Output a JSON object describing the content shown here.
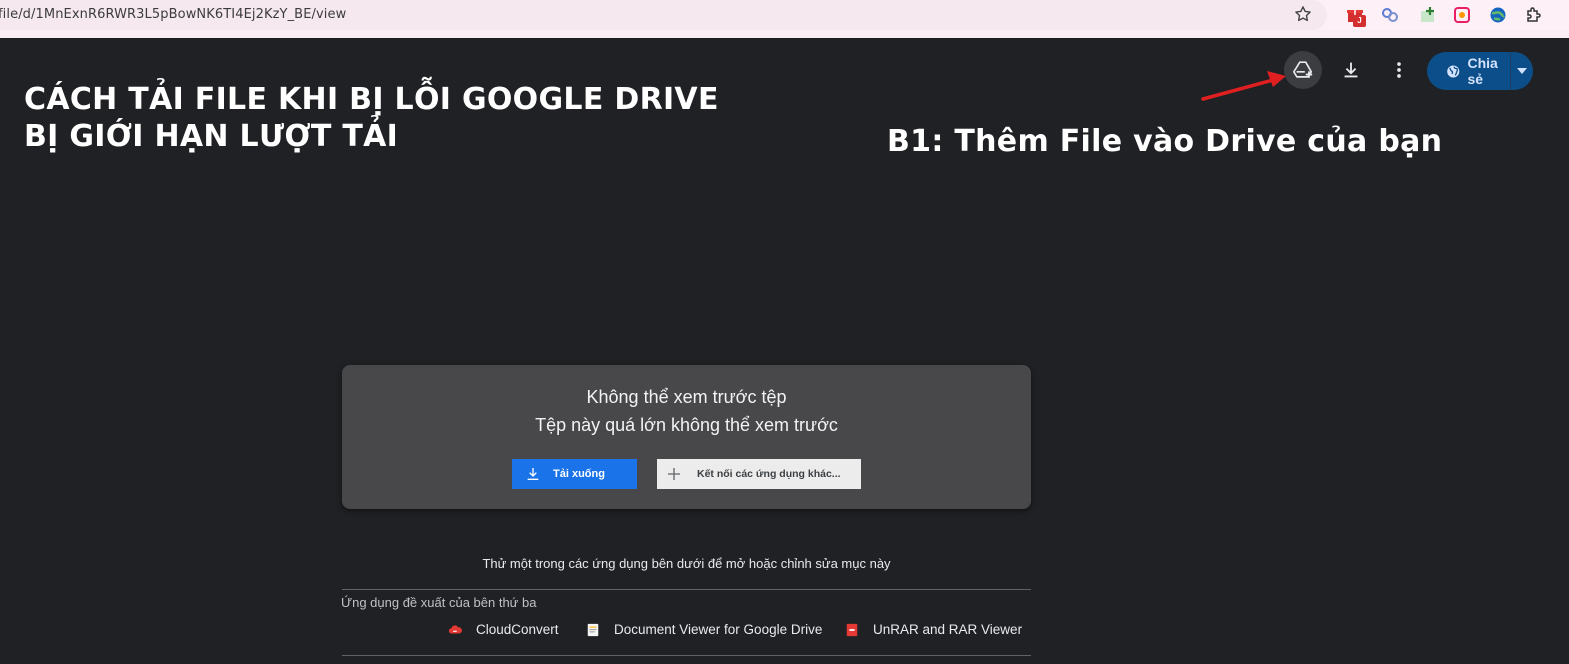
{
  "browser": {
    "url": "file/d/1MnExnR6RWR3L5pBowNK6TI4Ej2KzY_BE/view",
    "extension_badge": "J"
  },
  "toolbar": {
    "share_label": "Chia sẻ"
  },
  "annotation": {
    "title_line1": "CÁCH TẢI FILE KHI BỊ LỖI GOOGLE DRIVE",
    "title_line2": "BỊ GIỚI HẠN LƯỢT TẢI",
    "step1": "B1: Thêm File vào Drive của bạn",
    "arrow_color": "#e02020"
  },
  "preview": {
    "line1": "Không thể xem trước tệp",
    "line2": "Tệp này quá lớn không thể xem trước",
    "download_label": "Tải xuống",
    "connect_label": "Kết nối các ứng dụng khác..."
  },
  "apps": {
    "prompt": "Thử một trong các ứng dụng bên dưới để mở hoặc chỉnh sửa mục này",
    "section_label": "Ứng dụng đề xuất của bên thứ ba",
    "items": [
      {
        "name": "CloudConvert",
        "icon": "cloudconvert-icon"
      },
      {
        "name": "Document Viewer for Google Drive",
        "icon": "document-viewer-icon"
      },
      {
        "name": "UnRAR and RAR Viewer",
        "icon": "unrar-icon"
      }
    ]
  },
  "colors": {
    "background": "#202124",
    "primary_button": "#1a73e8",
    "share_button": "#0b4e89"
  }
}
